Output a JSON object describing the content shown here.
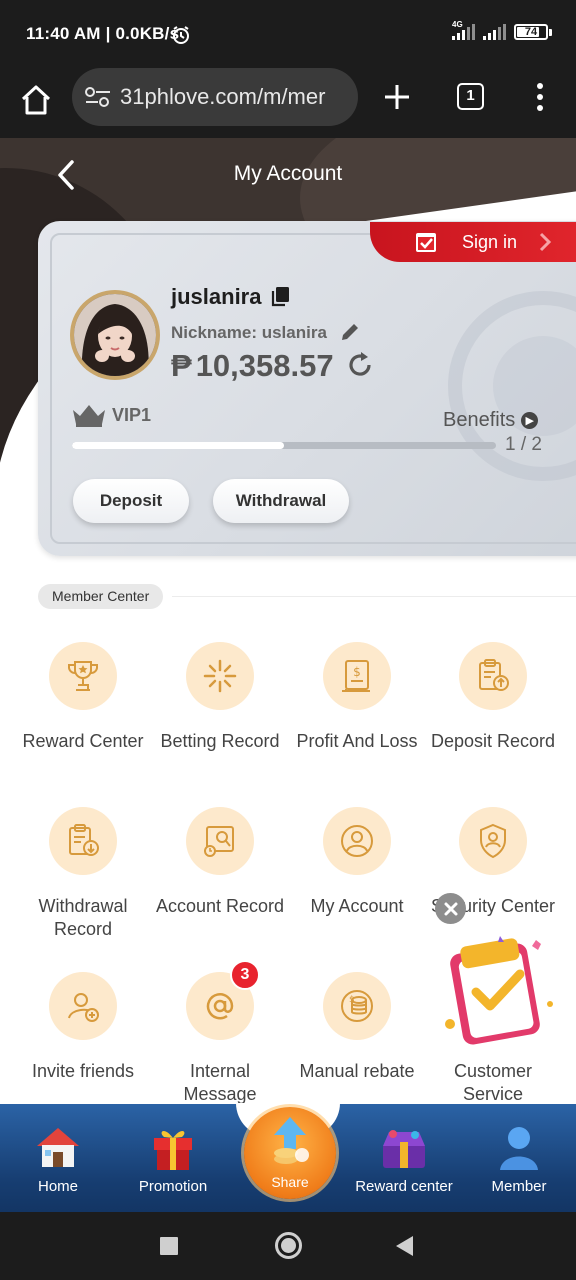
{
  "status_bar": {
    "time": "11:40 AM | 0.0KB/s",
    "network": "4G",
    "battery": "74"
  },
  "browser": {
    "url": "31phlove.com/m/mer",
    "tab_count": "1"
  },
  "header": {
    "title": "My Account"
  },
  "account": {
    "sign_in_label": "Sign in",
    "username": "juslanira",
    "nickname": "Nickname: uslanira",
    "currency_symbol": "₱",
    "balance": "10,358.57",
    "vip_level": "VIP1",
    "benefits_label": "Benefits",
    "vip_progress_text": "1 / 2",
    "vip_progress_fraction": 0.5,
    "deposit_label": "Deposit",
    "withdrawal_label": "Withdrawal"
  },
  "member_center": {
    "title": "Member Center",
    "items": [
      {
        "label": "Reward Center",
        "icon": "trophy-icon"
      },
      {
        "label": "Betting Record",
        "icon": "sparkle-icon"
      },
      {
        "label": "Profit And Loss",
        "icon": "ledger-icon"
      },
      {
        "label": "Deposit Record",
        "icon": "clipboard-upload-icon"
      },
      {
        "label": "Withdrawal Record",
        "icon": "clipboard-download-icon"
      },
      {
        "label": "Account Record",
        "icon": "record-search-icon"
      },
      {
        "label": "My Account",
        "icon": "user-icon"
      },
      {
        "label": "Security Center",
        "icon": "shield-user-icon"
      },
      {
        "label": "Invite friends",
        "icon": "add-user-icon"
      },
      {
        "label": "Internal Message",
        "icon": "at-icon",
        "badge": "3"
      },
      {
        "label": "Manual rebate",
        "icon": "coins-icon"
      },
      {
        "label": "Customer Service",
        "icon": "headset-icon"
      }
    ]
  },
  "bottom_nav": {
    "items": [
      {
        "label": "Home",
        "icon": "house-icon"
      },
      {
        "label": "Promotion",
        "icon": "gift-box-icon"
      },
      {
        "label": "Share",
        "icon": "share-arrow-icon"
      },
      {
        "label": "Reward center",
        "icon": "treasure-icon"
      },
      {
        "label": "Member",
        "icon": "person-icon"
      }
    ]
  },
  "colors": {
    "accent_red": "#e0252c",
    "icon_bg": "#fde9cc",
    "icon_stroke": "#d79a3c",
    "nav_blue": "#1b477f",
    "share_orange": "#f07d1a"
  }
}
